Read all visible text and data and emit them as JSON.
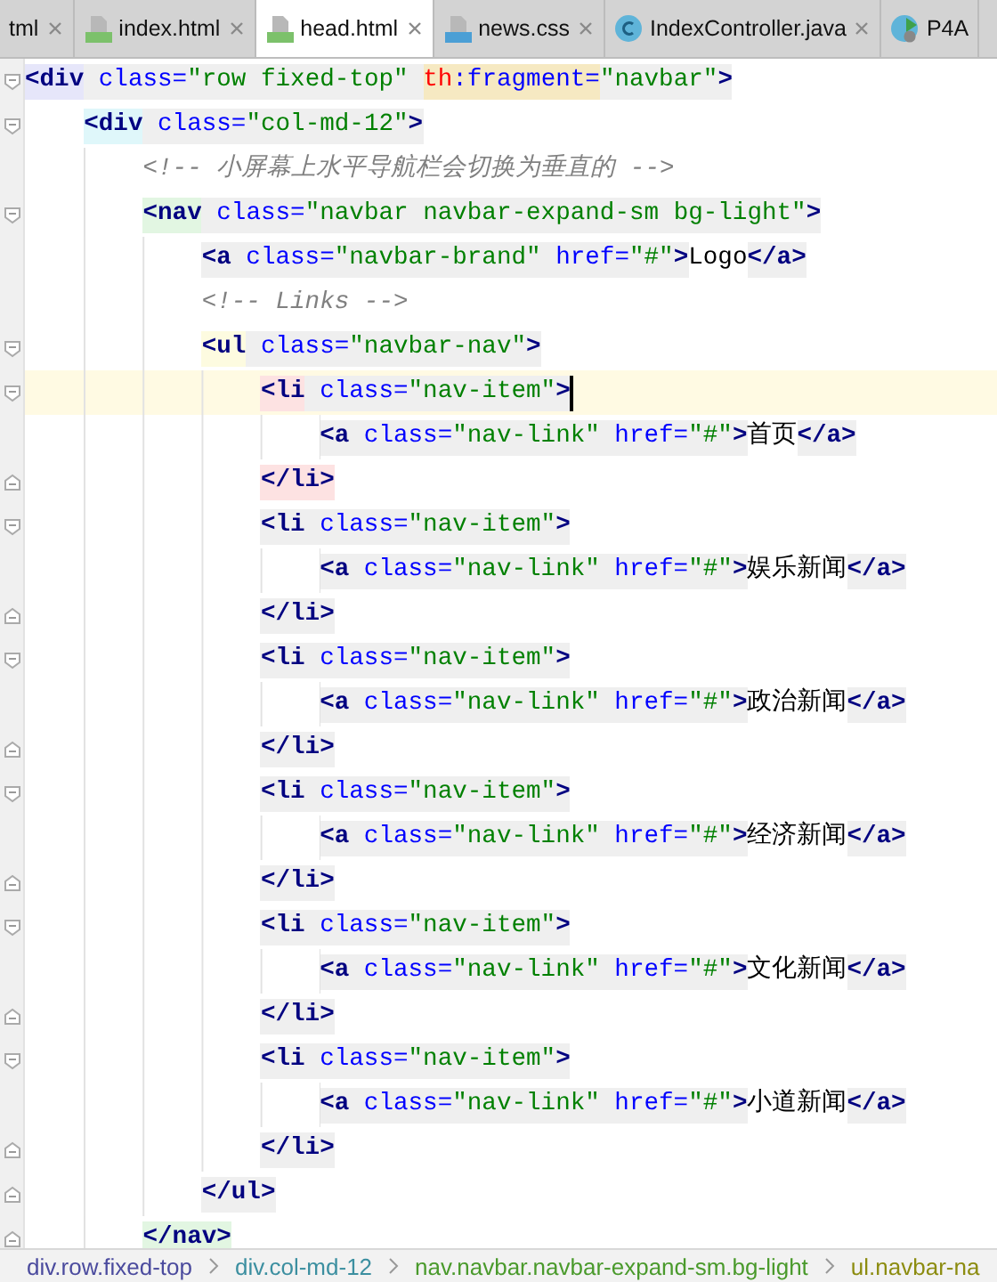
{
  "tabs": [
    {
      "label": "tml",
      "kind": "plain",
      "selected": false
    },
    {
      "label": "index.html",
      "kind": "html",
      "selected": false
    },
    {
      "label": "head.html",
      "kind": "html",
      "selected": true
    },
    {
      "label": "news.css",
      "kind": "css",
      "selected": false
    },
    {
      "label": "IndexController.java",
      "kind": "class",
      "selected": false
    },
    {
      "label": "P4A",
      "kind": "run",
      "selected": false
    }
  ],
  "lines": [
    {
      "fold_open": true,
      "fold_close": false,
      "current": false,
      "tokens": [
        {
          "kind": "tag",
          "text": "<div",
          "color": "#e6e6fa"
        },
        {
          "kind": "attr",
          "text": " class="
        },
        {
          "kind": "value",
          "text": "\"row fixed-top\" "
        },
        {
          "kind": "ns",
          "text": "th",
          "color": "#f6e9c2"
        },
        {
          "kind": "attr",
          "text": ":fragment=",
          "color": "#f6e9c2"
        },
        {
          "kind": "value",
          "text": "\"navbar\""
        },
        {
          "kind": "tag",
          "text": ">"
        }
      ],
      "children": [
        {
          "fold_open": true,
          "fold_close": false,
          "current": false,
          "tokens": [
            {
              "kind": "tag",
              "text": "<div",
              "color": "#dff7fa"
            },
            {
              "kind": "attr",
              "text": " class="
            },
            {
              "kind": "value",
              "text": "\"col-md-12\""
            },
            {
              "kind": "tag",
              "text": ">"
            }
          ],
          "children": [
            {
              "fold_open": false,
              "fold_close": false,
              "current": false,
              "tokens": [
                {
                  "kind": "comment",
                  "text": "<!-- 小屏幕上水平导航栏会切换为垂直的 -->"
                }
              ]
            },
            {
              "fold_open": true,
              "fold_close": false,
              "current": false,
              "tokens": [
                {
                  "kind": "tag",
                  "text": "<nav",
                  "color": "#e2f6e2"
                },
                {
                  "kind": "attr",
                  "text": " class="
                },
                {
                  "kind": "value",
                  "text": "\"navbar navbar-expand-sm bg-light\""
                },
                {
                  "kind": "tag",
                  "text": ">"
                }
              ],
              "children": [
                {
                  "fold_open": false,
                  "fold_close": false,
                  "current": false,
                  "tokens": [
                    {
                      "kind": "tag",
                      "text": "<a"
                    },
                    {
                      "kind": "attr",
                      "text": " class="
                    },
                    {
                      "kind": "value",
                      "text": "\"navbar-brand\""
                    },
                    {
                      "kind": "attr",
                      "text": " href="
                    },
                    {
                      "kind": "value",
                      "text": "\"#\""
                    },
                    {
                      "kind": "tag",
                      "text": ">"
                    },
                    {
                      "kind": "text",
                      "text": "Logo"
                    },
                    {
                      "kind": "tag",
                      "text": "</a>"
                    }
                  ]
                },
                {
                  "fold_open": false,
                  "fold_close": false,
                  "current": false,
                  "tokens": [
                    {
                      "kind": "comment",
                      "text": "<!-- Links -->"
                    }
                  ]
                },
                {
                  "fold_open": true,
                  "fold_close": false,
                  "current": false,
                  "tokens": [
                    {
                      "kind": "tag",
                      "text": "<ul",
                      "color": "#fdfbe0"
                    },
                    {
                      "kind": "attr",
                      "text": " class="
                    },
                    {
                      "kind": "value",
                      "text": "\"navbar-nav\""
                    },
                    {
                      "kind": "tag",
                      "text": ">"
                    }
                  ],
                  "children": [
                    {
                      "fold_open": true,
                      "fold_close": false,
                      "current": true,
                      "tokens": [
                        {
                          "kind": "tag",
                          "text": "<li",
                          "color": "#fde2e2"
                        },
                        {
                          "kind": "attr",
                          "text": " class="
                        },
                        {
                          "kind": "value",
                          "text": "\"nav-item\""
                        },
                        {
                          "kind": "tag",
                          "text": ">"
                        }
                      ],
                      "children": [
                        {
                          "fold_open": false,
                          "fold_close": false,
                          "current": false,
                          "tokens": [
                            {
                              "kind": "tag",
                              "text": "<a"
                            },
                            {
                              "kind": "attr",
                              "text": " class="
                            },
                            {
                              "kind": "value",
                              "text": "\"nav-link\""
                            },
                            {
                              "kind": "attr",
                              "text": " href="
                            },
                            {
                              "kind": "value",
                              "text": "\"#\""
                            },
                            {
                              "kind": "tag",
                              "text": ">"
                            },
                            {
                              "kind": "text",
                              "text": "首页"
                            },
                            {
                              "kind": "tag",
                              "text": "</a>"
                            }
                          ]
                        }
                      ]
                    },
                    {
                      "fold_open": false,
                      "fold_close": true,
                      "current": false,
                      "tokens": [
                        {
                          "kind": "tag",
                          "text": "</li>",
                          "color": "#fde2e2"
                        }
                      ]
                    },
                    {
                      "fold_open": true,
                      "fold_close": false,
                      "current": false,
                      "tokens": [
                        {
                          "kind": "tag",
                          "text": "<li"
                        },
                        {
                          "kind": "attr",
                          "text": " class="
                        },
                        {
                          "kind": "value",
                          "text": "\"nav-item\""
                        },
                        {
                          "kind": "tag",
                          "text": ">"
                        }
                      ],
                      "children": [
                        {
                          "fold_open": false,
                          "fold_close": false,
                          "current": false,
                          "tokens": [
                            {
                              "kind": "tag",
                              "text": "<a"
                            },
                            {
                              "kind": "attr",
                              "text": " class="
                            },
                            {
                              "kind": "value",
                              "text": "\"nav-link\""
                            },
                            {
                              "kind": "attr",
                              "text": " href="
                            },
                            {
                              "kind": "value",
                              "text": "\"#\""
                            },
                            {
                              "kind": "tag",
                              "text": ">"
                            },
                            {
                              "kind": "text",
                              "text": "娱乐新闻"
                            },
                            {
                              "kind": "tag",
                              "text": "</a>"
                            }
                          ]
                        }
                      ]
                    },
                    {
                      "fold_open": false,
                      "fold_close": true,
                      "current": false,
                      "tokens": [
                        {
                          "kind": "tag",
                          "text": "</li>"
                        }
                      ]
                    },
                    {
                      "fold_open": true,
                      "fold_close": false,
                      "current": false,
                      "tokens": [
                        {
                          "kind": "tag",
                          "text": "<li"
                        },
                        {
                          "kind": "attr",
                          "text": " class="
                        },
                        {
                          "kind": "value",
                          "text": "\"nav-item\""
                        },
                        {
                          "kind": "tag",
                          "text": ">"
                        }
                      ],
                      "children": [
                        {
                          "fold_open": false,
                          "fold_close": false,
                          "current": false,
                          "tokens": [
                            {
                              "kind": "tag",
                              "text": "<a"
                            },
                            {
                              "kind": "attr",
                              "text": " class="
                            },
                            {
                              "kind": "value",
                              "text": "\"nav-link\""
                            },
                            {
                              "kind": "attr",
                              "text": " href="
                            },
                            {
                              "kind": "value",
                              "text": "\"#\""
                            },
                            {
                              "kind": "tag",
                              "text": ">"
                            },
                            {
                              "kind": "text",
                              "text": "政治新闻"
                            },
                            {
                              "kind": "tag",
                              "text": "</a>"
                            }
                          ]
                        }
                      ]
                    },
                    {
                      "fold_open": false,
                      "fold_close": true,
                      "current": false,
                      "tokens": [
                        {
                          "kind": "tag",
                          "text": "</li>"
                        }
                      ]
                    },
                    {
                      "fold_open": true,
                      "fold_close": false,
                      "current": false,
                      "tokens": [
                        {
                          "kind": "tag",
                          "text": "<li"
                        },
                        {
                          "kind": "attr",
                          "text": " class="
                        },
                        {
                          "kind": "value",
                          "text": "\"nav-item\""
                        },
                        {
                          "kind": "tag",
                          "text": ">"
                        }
                      ],
                      "children": [
                        {
                          "fold_open": false,
                          "fold_close": false,
                          "current": false,
                          "tokens": [
                            {
                              "kind": "tag",
                              "text": "<a"
                            },
                            {
                              "kind": "attr",
                              "text": " class="
                            },
                            {
                              "kind": "value",
                              "text": "\"nav-link\""
                            },
                            {
                              "kind": "attr",
                              "text": " href="
                            },
                            {
                              "kind": "value",
                              "text": "\"#\""
                            },
                            {
                              "kind": "tag",
                              "text": ">"
                            },
                            {
                              "kind": "text",
                              "text": "经济新闻"
                            },
                            {
                              "kind": "tag",
                              "text": "</a>"
                            }
                          ]
                        }
                      ]
                    },
                    {
                      "fold_open": false,
                      "fold_close": true,
                      "current": false,
                      "tokens": [
                        {
                          "kind": "tag",
                          "text": "</li>"
                        }
                      ]
                    },
                    {
                      "fold_open": true,
                      "fold_close": false,
                      "current": false,
                      "tokens": [
                        {
                          "kind": "tag",
                          "text": "<li"
                        },
                        {
                          "kind": "attr",
                          "text": " class="
                        },
                        {
                          "kind": "value",
                          "text": "\"nav-item\""
                        },
                        {
                          "kind": "tag",
                          "text": ">"
                        }
                      ],
                      "children": [
                        {
                          "fold_open": false,
                          "fold_close": false,
                          "current": false,
                          "tokens": [
                            {
                              "kind": "tag",
                              "text": "<a"
                            },
                            {
                              "kind": "attr",
                              "text": " class="
                            },
                            {
                              "kind": "value",
                              "text": "\"nav-link\""
                            },
                            {
                              "kind": "attr",
                              "text": " href="
                            },
                            {
                              "kind": "value",
                              "text": "\"#\""
                            },
                            {
                              "kind": "tag",
                              "text": ">"
                            },
                            {
                              "kind": "text",
                              "text": "文化新闻"
                            },
                            {
                              "kind": "tag",
                              "text": "</a>"
                            }
                          ]
                        }
                      ]
                    },
                    {
                      "fold_open": false,
                      "fold_close": true,
                      "current": false,
                      "tokens": [
                        {
                          "kind": "tag",
                          "text": "</li>"
                        }
                      ]
                    },
                    {
                      "fold_open": true,
                      "fold_close": false,
                      "current": false,
                      "tokens": [
                        {
                          "kind": "tag",
                          "text": "<li"
                        },
                        {
                          "kind": "attr",
                          "text": " class="
                        },
                        {
                          "kind": "value",
                          "text": "\"nav-item\""
                        },
                        {
                          "kind": "tag",
                          "text": ">"
                        }
                      ],
                      "children": [
                        {
                          "fold_open": false,
                          "fold_close": false,
                          "current": false,
                          "tokens": [
                            {
                              "kind": "tag",
                              "text": "<a"
                            },
                            {
                              "kind": "attr",
                              "text": " class="
                            },
                            {
                              "kind": "value",
                              "text": "\"nav-link\""
                            },
                            {
                              "kind": "attr",
                              "text": " href="
                            },
                            {
                              "kind": "value",
                              "text": "\"#\""
                            },
                            {
                              "kind": "tag",
                              "text": ">"
                            },
                            {
                              "kind": "text",
                              "text": "小道新闻"
                            },
                            {
                              "kind": "tag",
                              "text": "</a>"
                            }
                          ]
                        }
                      ]
                    },
                    {
                      "fold_open": false,
                      "fold_close": true,
                      "current": false,
                      "tokens": [
                        {
                          "kind": "tag",
                          "text": "</li>"
                        }
                      ]
                    }
                  ]
                },
                {
                  "fold_open": false,
                  "fold_close": true,
                  "current": false,
                  "tokens": [
                    {
                      "kind": "tag",
                      "text": "</ul>"
                    }
                  ]
                }
              ]
            },
            {
              "fold_open": false,
              "fold_close": true,
              "current": false,
              "tokens": [
                {
                  "kind": "tag",
                  "text": "</nav>",
                  "color": "#e2f6e2"
                }
              ]
            }
          ]
        }
      ]
    }
  ],
  "breadcrumbs": [
    {
      "label": "div.row.fixed-top",
      "color": "#4b4b9e"
    },
    {
      "label": "div.col-md-12",
      "color": "#3c8fa0"
    },
    {
      "label": "nav.navbar.navbar-expand-sm.bg-light",
      "color": "#4a9a2c"
    },
    {
      "label": "ul.navbar-na",
      "color": "#8c8c10"
    }
  ]
}
